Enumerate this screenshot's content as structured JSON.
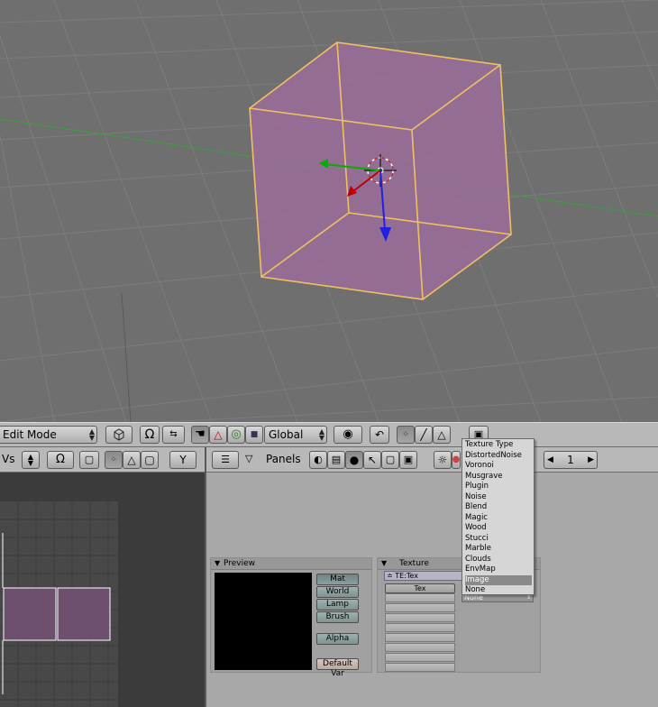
{
  "header3d": {
    "mode": "Edit Mode",
    "orientation": "Global",
    "icons": [
      "mesh-select-icon",
      "magnet-icon",
      "arrows-icon",
      "hand-icon",
      "rotate-icon",
      "scale-icon",
      "manipulator-icon",
      "pivot-icon",
      "proportional-icon",
      "vertex-select-icon",
      "edge-select-icon",
      "face-select-icon",
      "render-icon"
    ]
  },
  "uv_header": {
    "label": "Vs"
  },
  "buttons_header": {
    "panels_label": "Panels",
    "frame": "1"
  },
  "preview_panel": {
    "title": "Preview",
    "buttons": [
      "Mat",
      "World",
      "Lamp",
      "Brush"
    ],
    "alpha": "Alpha",
    "default_var": "Default Var"
  },
  "texture_panel": {
    "title": "Texture",
    "te_field": "TE:Tex",
    "channel_label": "Tex",
    "none_select": "None"
  },
  "texture_menu": {
    "items": [
      "Texture Type",
      "DistortedNoise",
      "Voronoi",
      "Musgrave",
      "Plugin",
      "Noise",
      "Blend",
      "Magic",
      "Wood",
      "Stucci",
      "Marble",
      "Clouds",
      "EnvMap",
      "Image",
      "None"
    ],
    "highlighted": "Image"
  },
  "colors": {
    "viewport_bg": "#6f6f6f",
    "cube_face": "#9a6d9a",
    "cube_edge": "#f0c060",
    "grid": "#7c7c7c",
    "x_axis": "#c00000",
    "y_axis": "#00b000",
    "z_axis": "#2020e0"
  }
}
